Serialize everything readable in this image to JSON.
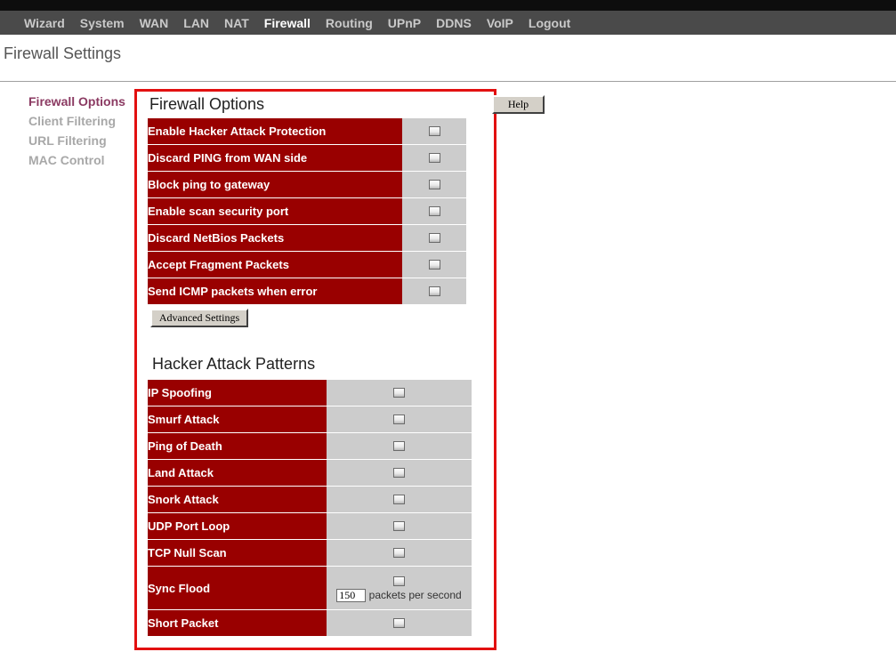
{
  "topnav": {
    "items": [
      "Wizard",
      "System",
      "WAN",
      "LAN",
      "NAT",
      "Firewall",
      "Routing",
      "UPnP",
      "DDNS",
      "VoIP",
      "Logout"
    ]
  },
  "page_title": "Firewall Settings",
  "sidenav": {
    "items": [
      "Firewall Options",
      "Client Filtering",
      "URL Filtering",
      "MAC Control"
    ]
  },
  "firewall_options": {
    "title": "Firewall Options",
    "rows": [
      "Enable Hacker Attack Protection",
      "Discard PING from WAN side",
      "Block ping to gateway",
      "Enable scan security port",
      "Discard NetBios Packets",
      "Accept Fragment Packets",
      "Send ICMP packets when error"
    ],
    "advanced_button": "Advanced Settings"
  },
  "help_button": "Help",
  "hacker_patterns": {
    "title": "Hacker Attack Patterns",
    "rows": [
      "IP Spoofing",
      "Smurf Attack",
      "Ping of Death",
      "Land Attack",
      "Snork Attack",
      "UDP Port Loop",
      "TCP Null Scan",
      "Sync Flood",
      "Short Packet"
    ],
    "sync_flood_value": "150",
    "sync_flood_unit": "packets per second"
  },
  "colors": {
    "label_bg": "#990000",
    "value_bg": "#cccccc",
    "highlight_border": "#e21010",
    "nav_bg": "#4a4a4a"
  }
}
